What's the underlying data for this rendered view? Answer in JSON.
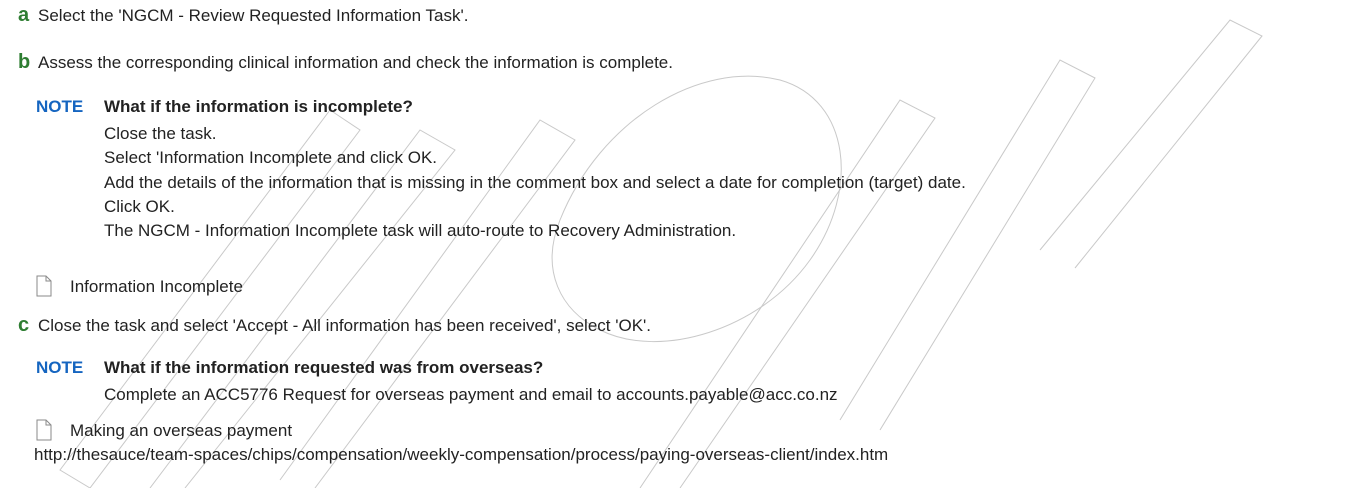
{
  "steps": {
    "a": {
      "letter": "a",
      "text": "Select the 'NGCM - Review Requested Information Task'."
    },
    "b": {
      "letter": "b",
      "text": "Assess the corresponding clinical information and check the information is complete."
    },
    "c": {
      "letter": "c",
      "text": "Close the task and select 'Accept - All information has been received', select 'OK'."
    }
  },
  "note1": {
    "label": "NOTE",
    "title": "What if the information is incomplete?",
    "lines": [
      "Close the task.",
      "Select 'Information Incomplete and click OK.",
      "Add the details of the information that is missing in the comment box and select a date for completion (target) date.",
      "Click OK.",
      "The NGCM - Information Incomplete task will auto-route to Recovery Administration."
    ]
  },
  "link1": {
    "icon": "document-icon",
    "text": "Information Incomplete"
  },
  "note2": {
    "label": "NOTE",
    "title": "What if the information requested was from overseas?",
    "lines": [
      "Complete an ACC5776 Request for overseas payment and email to accounts.payable@acc.co.nz"
    ]
  },
  "link2": {
    "icon": "document-icon",
    "text": "Making an overseas payment",
    "url": "http://thesauce/team-spaces/chips/compensation/weekly-compensation/process/paying-overseas-client/index.htm"
  },
  "colors": {
    "step_letter": "#2e7d32",
    "note_label": "#1565c0",
    "text": "#222222"
  }
}
